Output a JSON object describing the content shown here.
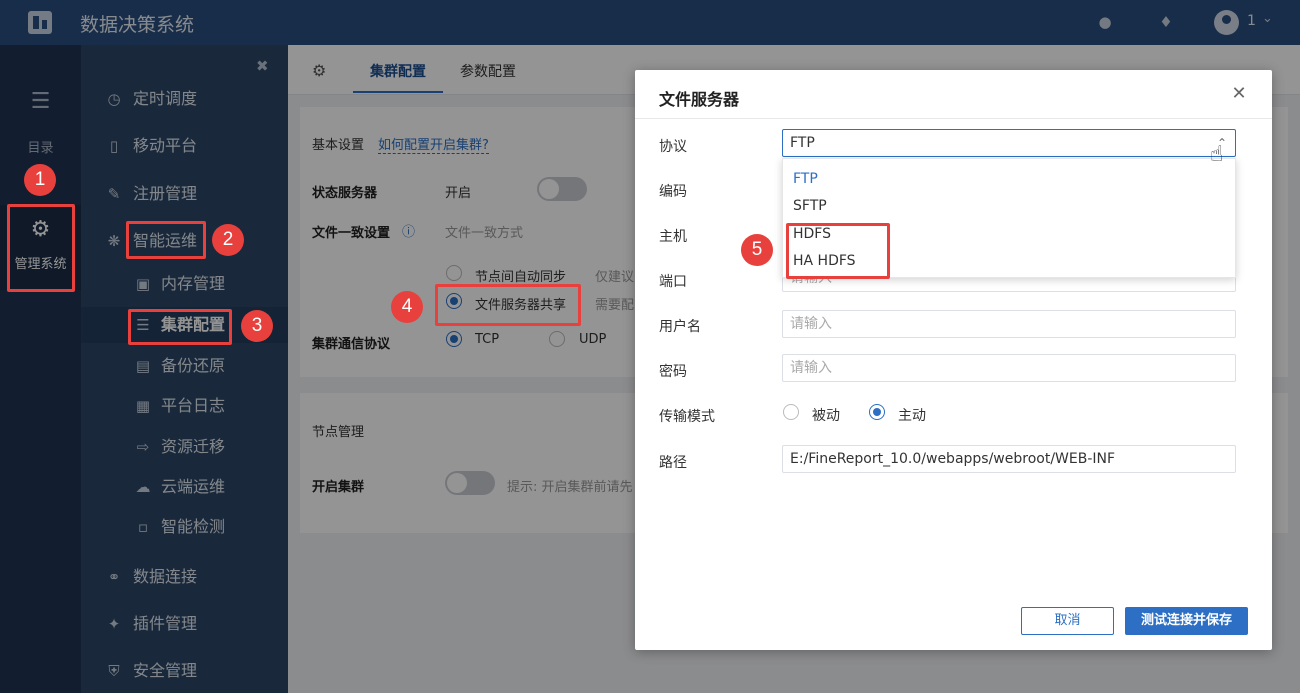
{
  "header": {
    "app_title": "数据决策系统",
    "user_name": "1"
  },
  "nav1": {
    "directory_label": "目录",
    "admin_label": "管理系统"
  },
  "nav2": {
    "items": [
      {
        "label": "定时调度"
      },
      {
        "label": "移动平台"
      },
      {
        "label": "注册管理"
      },
      {
        "label": "智能运维"
      },
      {
        "label": "内存管理"
      },
      {
        "label": "集群配置"
      },
      {
        "label": "备份还原"
      },
      {
        "label": "平台日志"
      },
      {
        "label": "资源迁移"
      },
      {
        "label": "云端运维"
      },
      {
        "label": "智能检测"
      },
      {
        "label": "数据连接"
      },
      {
        "label": "插件管理"
      },
      {
        "label": "安全管理"
      }
    ]
  },
  "main": {
    "tabs": [
      {
        "label": "集群配置"
      },
      {
        "label": "参数配置"
      }
    ],
    "basic_settings": "基本设置",
    "basic_settings_link": "如何配置开启集群?",
    "status_server_label": "状态服务器",
    "status_server_value": "开启",
    "file_consistency_label": "文件一致设置",
    "file_consistency_hint": "文件一致方式",
    "sync_option": "节点间自动同步",
    "sync_note": "仅建议",
    "file_share_option": "文件服务器共享",
    "file_share_note": "需要配",
    "comm_protocol_label": "集群通信协议",
    "tcp": "TCP",
    "udp": "UDP",
    "node_mgmt": "节点管理",
    "enable_cluster_label": "开启集群",
    "enable_cluster_hint": "提示: 开启集群前请先"
  },
  "modal": {
    "title": "文件服务器",
    "protocol_label": "协议",
    "protocol_value": "FTP",
    "protocol_options": [
      "FTP",
      "SFTP",
      "HDFS",
      "HA HDFS"
    ],
    "encoding_label": "编码",
    "host_label": "主机",
    "port_label": "端口",
    "port_placeholder": "请输入",
    "username_label": "用户名",
    "username_placeholder": "请输入",
    "password_label": "密码",
    "password_placeholder": "请输入",
    "transfer_mode_label": "传输模式",
    "passive": "被动",
    "active": "主动",
    "path_label": "路径",
    "path_value": "E:/FineReport_10.0/webapps/webroot/WEB-INF",
    "cancel_label": "取消",
    "save_label": "测试连接并保存"
  },
  "annotations": [
    "1",
    "2",
    "3",
    "4",
    "5"
  ]
}
